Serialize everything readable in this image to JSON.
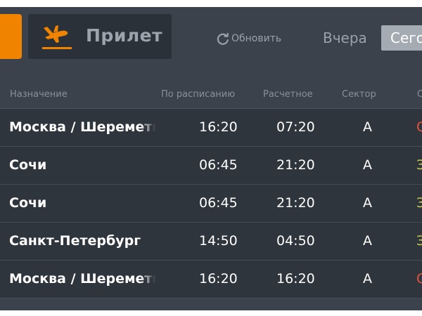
{
  "toolbar": {
    "arrivals_label": "Прилет",
    "refresh_label": "Обновить",
    "day_yesterday": "Вчера",
    "day_today": "Сего"
  },
  "columns": {
    "destination": "Назначение",
    "scheduled": "По расписанию",
    "estimated": "Расчетное",
    "sector": "Сектор",
    "status": "С"
  },
  "flights": [
    {
      "destination": "Москва / Шереметьево",
      "scheduled": "16:20",
      "estimated": "07:20",
      "sector": "A",
      "status": "С",
      "status_color": "#e8543a"
    },
    {
      "destination": "Сочи",
      "scheduled": "06:45",
      "estimated": "21:20",
      "sector": "A",
      "status": "З",
      "status_color": "#c8c84a"
    },
    {
      "destination": "Сочи",
      "scheduled": "06:45",
      "estimated": "21:20",
      "sector": "A",
      "status": "З",
      "status_color": "#c8c84a"
    },
    {
      "destination": "Санкт-Петербург",
      "scheduled": "14:50",
      "estimated": "04:50",
      "sector": "A",
      "status": "З",
      "status_color": "#c8c84a"
    },
    {
      "destination": "Москва / Шереметьево",
      "scheduled": "16:20",
      "estimated": "16:20",
      "sector": "A",
      "status": "С",
      "status_color": "#e8543a"
    }
  ],
  "colors": {
    "accent_orange": "#f08300",
    "board_bg": "#3b424b",
    "row_bg": "#2f353d"
  }
}
